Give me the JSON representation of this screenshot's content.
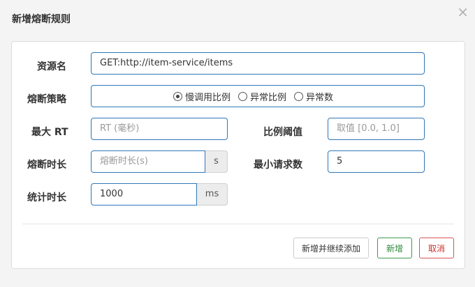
{
  "dialog": {
    "title": "新增熔断规则",
    "close_glyph": "×"
  },
  "form": {
    "resource": {
      "label": "资源名",
      "value": "GET:http://item-service/items"
    },
    "strategy": {
      "label": "熔断策略",
      "options": [
        "慢调用比例",
        "异常比例",
        "异常数"
      ],
      "selected": "慢调用比例"
    },
    "max_rt": {
      "label": "最大 RT",
      "value": "",
      "placeholder": "RT (毫秒)"
    },
    "ratio_threshold": {
      "label": "比例阈值",
      "value": "",
      "placeholder": "取值 [0.0, 1.0]"
    },
    "break_duration": {
      "label": "熔断时长",
      "value": "",
      "placeholder": "熔断时长(s)",
      "unit": "s"
    },
    "min_requests": {
      "label": "最小请求数",
      "value": "5"
    },
    "stat_duration": {
      "label": "统计时长",
      "value": "1000",
      "unit": "ms"
    }
  },
  "footer": {
    "add_continue_label": "新增并继续添加",
    "add_label": "新增",
    "cancel_label": "取消"
  },
  "colors": {
    "field_border": "#2f78b7",
    "success": "#3c9a4a",
    "danger": "#d9534f"
  }
}
